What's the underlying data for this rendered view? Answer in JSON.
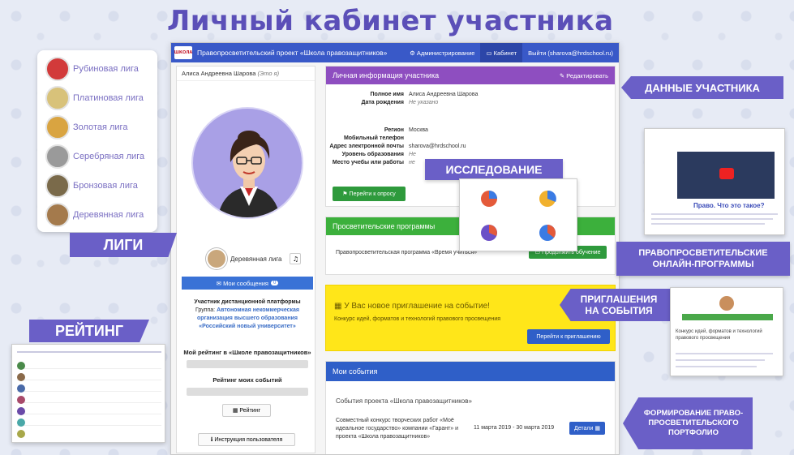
{
  "hero_title": "Личный кабинет участника",
  "app": {
    "project_title": "Правопросветительский проект «Школа правозащитников»",
    "nav_admin": "⚙ Администрирование",
    "nav_cabinet": "Кабинет",
    "nav_logout": "Выйти (sharova@hrdschool.ru)",
    "logo_text": "ШКОЛА"
  },
  "profile": {
    "name": "Алиса Андреевна Шарова",
    "me_tag": "(Это я)",
    "league": "Деревянная лига",
    "messages_label": "Мои сообщения",
    "messages_count": "0",
    "participant_title": "Участник дистанционной платформы",
    "group_prefix": "Группа:",
    "group_org": "Автономная некоммерческая организация высшего образования «Российский новый университет»",
    "rating_label": "Мой рейтинг в «Школе правозащитников»",
    "events_rating_label": "Рейтинг моих событий",
    "rating_button": "Рейтинг",
    "manual_button": "Инструкция пользователя"
  },
  "personal_info": {
    "title": "Личная информация участника",
    "edit": "Редактировать",
    "rows": [
      {
        "k": "Полное имя",
        "v": "Алиса Андреевна Шарова"
      },
      {
        "k": "Дата рождения",
        "v": "Не указано"
      },
      {
        "k": "Регион",
        "v": "Москва"
      },
      {
        "k": "Мобильный телефон",
        "v": ""
      },
      {
        "k": "Адрес электронной почты",
        "v": "sharova@hrdschool.ru"
      },
      {
        "k": "Уровень образования",
        "v": "Не"
      },
      {
        "k": "Место учебы или работы",
        "v": "не"
      }
    ],
    "survey_button": "Перейти к опросу"
  },
  "programs": {
    "title": "Просветительские программы",
    "item": "Правопросветительская программа «Время учиться»",
    "continue_button": "Продолжить обучение"
  },
  "invitation": {
    "title": "У Вас новое приглашение на событие!",
    "text": "Конкурс идей, форматов и технологий правового просвещения",
    "button": "Перейти к приглашению"
  },
  "events": {
    "title": "Мои события",
    "subtitle": "События проекта «Школа правозащитников»",
    "item_text": "Совместный конкурс творческих работ «Моё идеальное государство» компании «Гарант» и проекта «Школа правозащитников»",
    "item_date": "11 марта 2019 - 30 марта 2019",
    "details_button": "Детали"
  },
  "leagues": [
    {
      "name": "Рубиновая лига",
      "color": "#d23a3a"
    },
    {
      "name": "Платиновая лига",
      "color": "#d8c27a"
    },
    {
      "name": "Золотая лига",
      "color": "#d9a441"
    },
    {
      "name": "Серебряная лига",
      "color": "#9a9a9a"
    },
    {
      "name": "Бронзовая лига",
      "color": "#7a6a4a"
    },
    {
      "name": "Деревянная лига",
      "color": "#a47a4c"
    }
  ],
  "ribbons": {
    "leagues": "ЛИГИ",
    "rating": "РЕЙТИНГ",
    "participant_data": "ДАННЫЕ УЧАСТНИКА",
    "research": "ИССЛЕДОВАНИЕ",
    "online_programs": "ПРАВОПРОСВЕТИТЕЛЬСКИЕ ОНЛАЙН-ПРОГРАММЫ",
    "invitations": "ПРИГЛАШЕНИЯ НА СОБЫТИЯ",
    "portfolio": "ФОРМИРОВАНИЕ ПРАВО-ПРОСВЕТИТЕЛЬСКОГО ПОРТФОЛИО"
  },
  "popups": {
    "video_question": "Право. Что это такое?",
    "invite_button": "Конкурс идей, форматов и технологий правового просвещения"
  }
}
